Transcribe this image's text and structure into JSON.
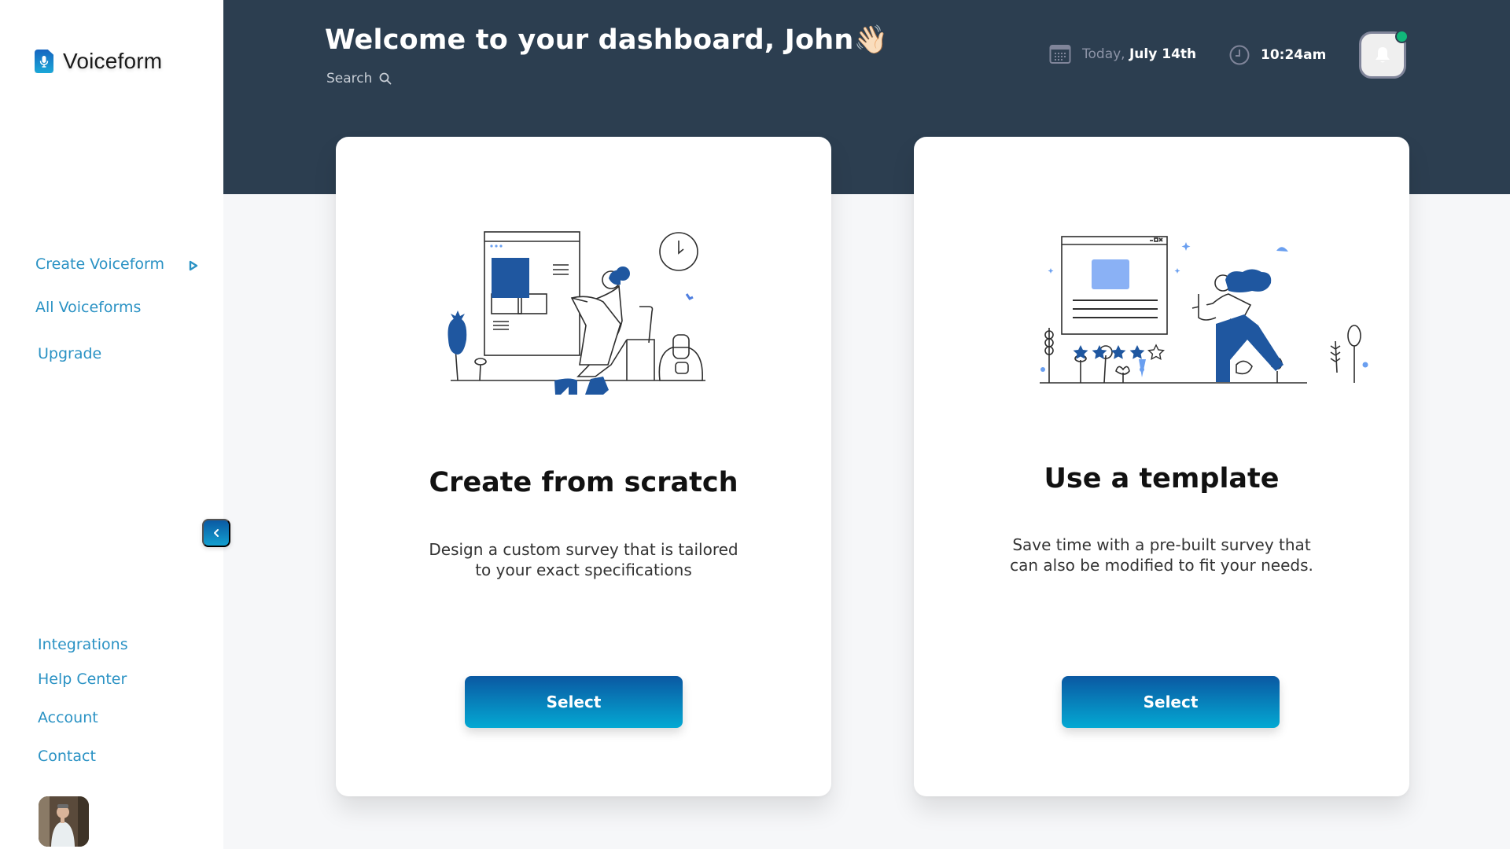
{
  "app": {
    "name": "Voiceform",
    "brand_gradient": [
      "#1565c0",
      "#1ba8d8"
    ],
    "accent_color": "#2a92c4",
    "header_color": "#2c3e50"
  },
  "sidebar": {
    "primary_nav": [
      {
        "label": "Create Voiceform",
        "icon": "play-outline-icon"
      },
      {
        "label": "All Voiceforms"
      },
      {
        "label": "Upgrade"
      }
    ],
    "secondary_nav": [
      {
        "label": "Integrations"
      },
      {
        "label": "Help Center"
      },
      {
        "label": "Account"
      },
      {
        "label": "Contact"
      }
    ],
    "collapse_icon": "chevron-left-icon",
    "avatar_alt": "User avatar"
  },
  "header": {
    "welcome": "Welcome to your dashboard, John",
    "welcome_emoji": "👋🏻",
    "search_label": "Search",
    "date_prefix": "Today,",
    "date_value": "July 14th",
    "time_value": "10:24am",
    "notification_status_color": "#11b77a"
  },
  "cards": [
    {
      "title": "Create from scratch",
      "description_line1": "Design a custom survey that is tailored",
      "description_line2": "to your exact specifications",
      "button_label": "Select",
      "illustration": "woman-at-screen-illustration"
    },
    {
      "title": "Use a template",
      "description_line1": "Save time with a pre-built survey that",
      "description_line2": "can also be modified to fit your needs.",
      "button_label": "Select",
      "illustration": "template-rating-illustration",
      "rating_filled": 4,
      "rating_max": 5
    }
  ]
}
